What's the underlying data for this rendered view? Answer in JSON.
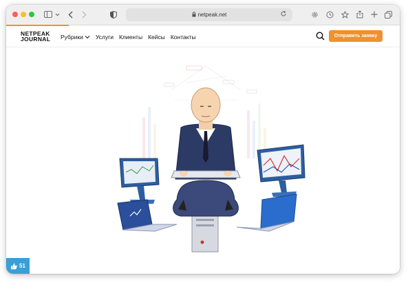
{
  "browser": {
    "url": "netpeak.net",
    "icons": [
      "sidebar-icon",
      "chevron-down-icon",
      "back-icon",
      "forward-icon",
      "shield-icon",
      "tab-icon",
      "lock-icon",
      "reload-icon",
      "settings-icon",
      "history-icon",
      "star-icon",
      "share-icon",
      "plus-icon",
      "tabs-icon"
    ]
  },
  "site": {
    "logo_line1": "NETPEAK",
    "logo_line2": "JOURNAL",
    "menu": [
      {
        "label": "Рубрики"
      },
      {
        "label": "Услуги"
      },
      {
        "label": "Клиенты"
      },
      {
        "label": "Кейсы"
      },
      {
        "label": "Контакты"
      }
    ],
    "cta_label": "Отправить заявку",
    "accent_color": "#f0912b"
  },
  "likes": {
    "count": "51",
    "color": "#3a9fd6"
  }
}
